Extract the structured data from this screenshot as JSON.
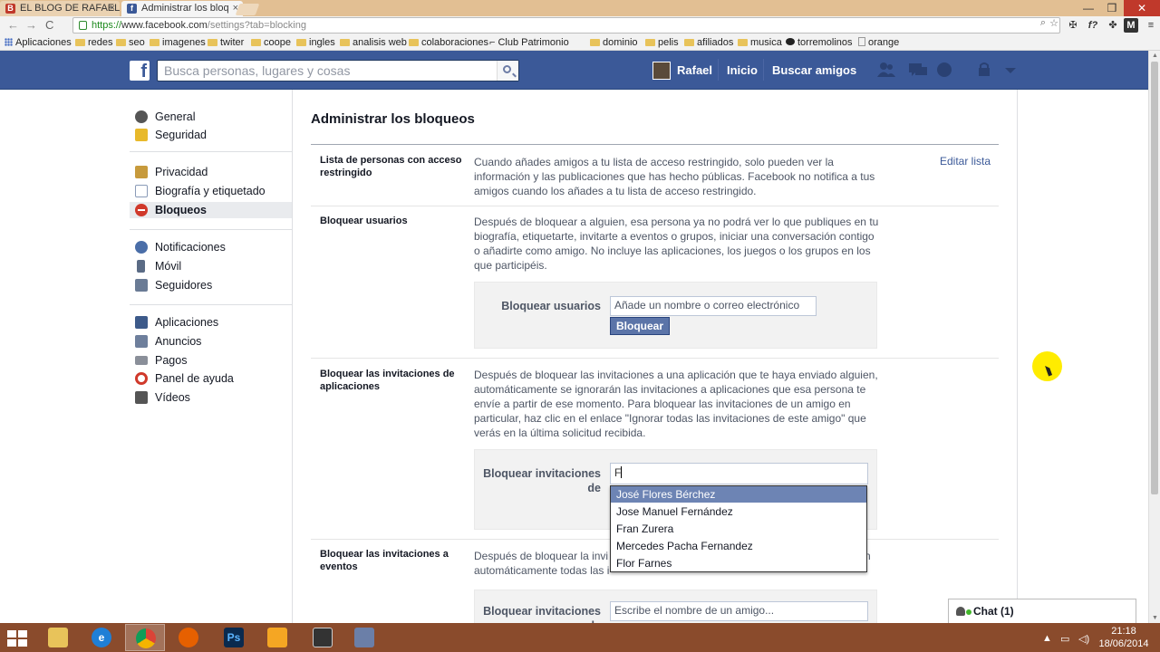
{
  "browser": {
    "tabs": [
      {
        "label": "EL BLOG DE RAFAEL",
        "close": "×"
      },
      {
        "label": "Administrar los bloq",
        "close": "×"
      }
    ],
    "window_controls": [
      "—",
      "❒",
      "✕"
    ],
    "url_scheme": "https://",
    "url_host": "www.facebook.com",
    "url_path": "/settings?tab=blocking",
    "nav_back": "←",
    "nav_forward": "→",
    "nav_reload": "C",
    "zoom_icon": "⌕",
    "star_icon": "☆",
    "ext_icons": [
      "✠",
      "f?",
      "✤",
      "M",
      "≡"
    ],
    "bookmarks": [
      {
        "label": "Aplicaciones",
        "icon": "apps-grid"
      },
      {
        "label": "redes",
        "icon": "folder"
      },
      {
        "label": "seo",
        "icon": "folder"
      },
      {
        "label": "imagenes",
        "icon": "folder"
      },
      {
        "label": "twiter",
        "icon": "folder"
      },
      {
        "label": "coope",
        "icon": "folder"
      },
      {
        "label": "ingles",
        "icon": "folder"
      },
      {
        "label": "analisis web",
        "icon": "folder"
      },
      {
        "label": "colaboraciones",
        "icon": "folder"
      },
      {
        "label": "Club Patrimonio",
        "icon": "site"
      },
      {
        "label": "dominio",
        "icon": "folder"
      },
      {
        "label": "pelis",
        "icon": "folder"
      },
      {
        "label": "afiliados",
        "icon": "folder"
      },
      {
        "label": "musica",
        "icon": "folder"
      },
      {
        "label": "torremolinos",
        "icon": "site"
      },
      {
        "label": "orange",
        "icon": "page"
      }
    ]
  },
  "fb_header": {
    "logo": "f",
    "search_placeholder": "Busca personas, lugares y cosas",
    "user_name": "Rafael",
    "home_label": "Inicio",
    "find_friends_label": "Buscar amigos"
  },
  "sidebar": {
    "items": [
      {
        "label": "General",
        "icon": "gear-icon",
        "color": "#555555"
      },
      {
        "label": "Seguridad",
        "icon": "badge-icon",
        "color": "#e8b92b"
      },
      {
        "label": "Privacidad",
        "icon": "lock-icon",
        "color": "#c79a3c"
      },
      {
        "label": "Biografía y etiquetado",
        "icon": "timeline-icon",
        "color": "#8a9bb8"
      },
      {
        "label": "Bloqueos",
        "icon": "block-icon",
        "color": "#d0392b"
      },
      {
        "label": "Notificaciones",
        "icon": "globe-icon",
        "color": "#4a6ea8"
      },
      {
        "label": "Móvil",
        "icon": "mobile-icon",
        "color": "#5a6b85"
      },
      {
        "label": "Seguidores",
        "icon": "rss-icon",
        "color": "#6a7b95"
      },
      {
        "label": "Aplicaciones",
        "icon": "apps-icon",
        "color": "#3d5a8a"
      },
      {
        "label": "Anuncios",
        "icon": "ads-icon",
        "color": "#6e7f9c"
      },
      {
        "label": "Pagos",
        "icon": "card-icon",
        "color": "#8a8f99"
      },
      {
        "label": "Panel de ayuda",
        "icon": "lifebuoy-icon",
        "color": "#d0392b"
      },
      {
        "label": "Vídeos",
        "icon": "film-icon",
        "color": "#555555"
      }
    ]
  },
  "main": {
    "title": "Administrar los bloqueos",
    "restricted": {
      "label": "Lista de personas con acceso restringido",
      "text": "Cuando añades amigos a tu lista de acceso restringido, solo pueden ver la información y las publicaciones que has hecho públicas. Facebook no notifica a tus amigos cuando los añades a tu lista de acceso restringido.",
      "edit_link": "Editar lista"
    },
    "block_users": {
      "label": "Bloquear usuarios",
      "text": "Después de bloquear a alguien, esa persona ya no podrá ver lo que publiques en tu biografía, etiquetarte, invitarte a eventos o grupos, iniciar una conversación contigo o añadirte como amigo. No incluye las aplicaciones, los juegos o los grupos en los que participéis.",
      "panel_label": "Bloquear usuarios",
      "input_placeholder": "Añade un nombre o correo electrónico",
      "button": "Bloquear"
    },
    "block_app_invites": {
      "label": "Bloquear las invitaciones de aplicaciones",
      "text": "Después de bloquear las invitaciones a una aplicación que te haya enviado alguien, automáticamente se ignorarán las invitaciones a aplicaciones que esa persona te envíe a partir de ese momento. Para bloquear las invitaciones de un amigo en particular, haz clic en el enlace \"Ignorar todas las invitaciones de este amigo\" que verás en la última solicitud recibida.",
      "panel_label": "Bloquear invitaciones de",
      "input_value": "F",
      "suggestions": [
        "José Flores Bérchez",
        "Jose Manuel Fernández",
        "Fran Zurera",
        "Mercedes Pacha Fernandez",
        "Flor Farnes"
      ],
      "selected_index": 0
    },
    "block_event_invites": {
      "label": "Bloquear las invitaciones a eventos",
      "text_line1": "Después de bloquear la invi",
      "text_line1_tail": "n",
      "text_line2": "automáticamente todas las i",
      "panel_label": "Bloquear invitaciones de",
      "input_placeholder": "Escribe el nombre de un amigo..."
    }
  },
  "chat": {
    "label": "Chat (1)"
  },
  "taskbar": {
    "apps": [
      "explorer",
      "internet-explorer",
      "chrome",
      "firefox",
      "photoshop",
      "outlook",
      "app-tool",
      "virtualbox"
    ],
    "ps_label": "Ps",
    "time": "21:18",
    "date": "18/06/2014"
  },
  "colors": {
    "fb_blue": "#3b5998",
    "link": "#3b5998",
    "selected_suggestion": "#6d84b4",
    "taskbar": "#8a4b2c",
    "tabstrip": "#e2bf93"
  }
}
